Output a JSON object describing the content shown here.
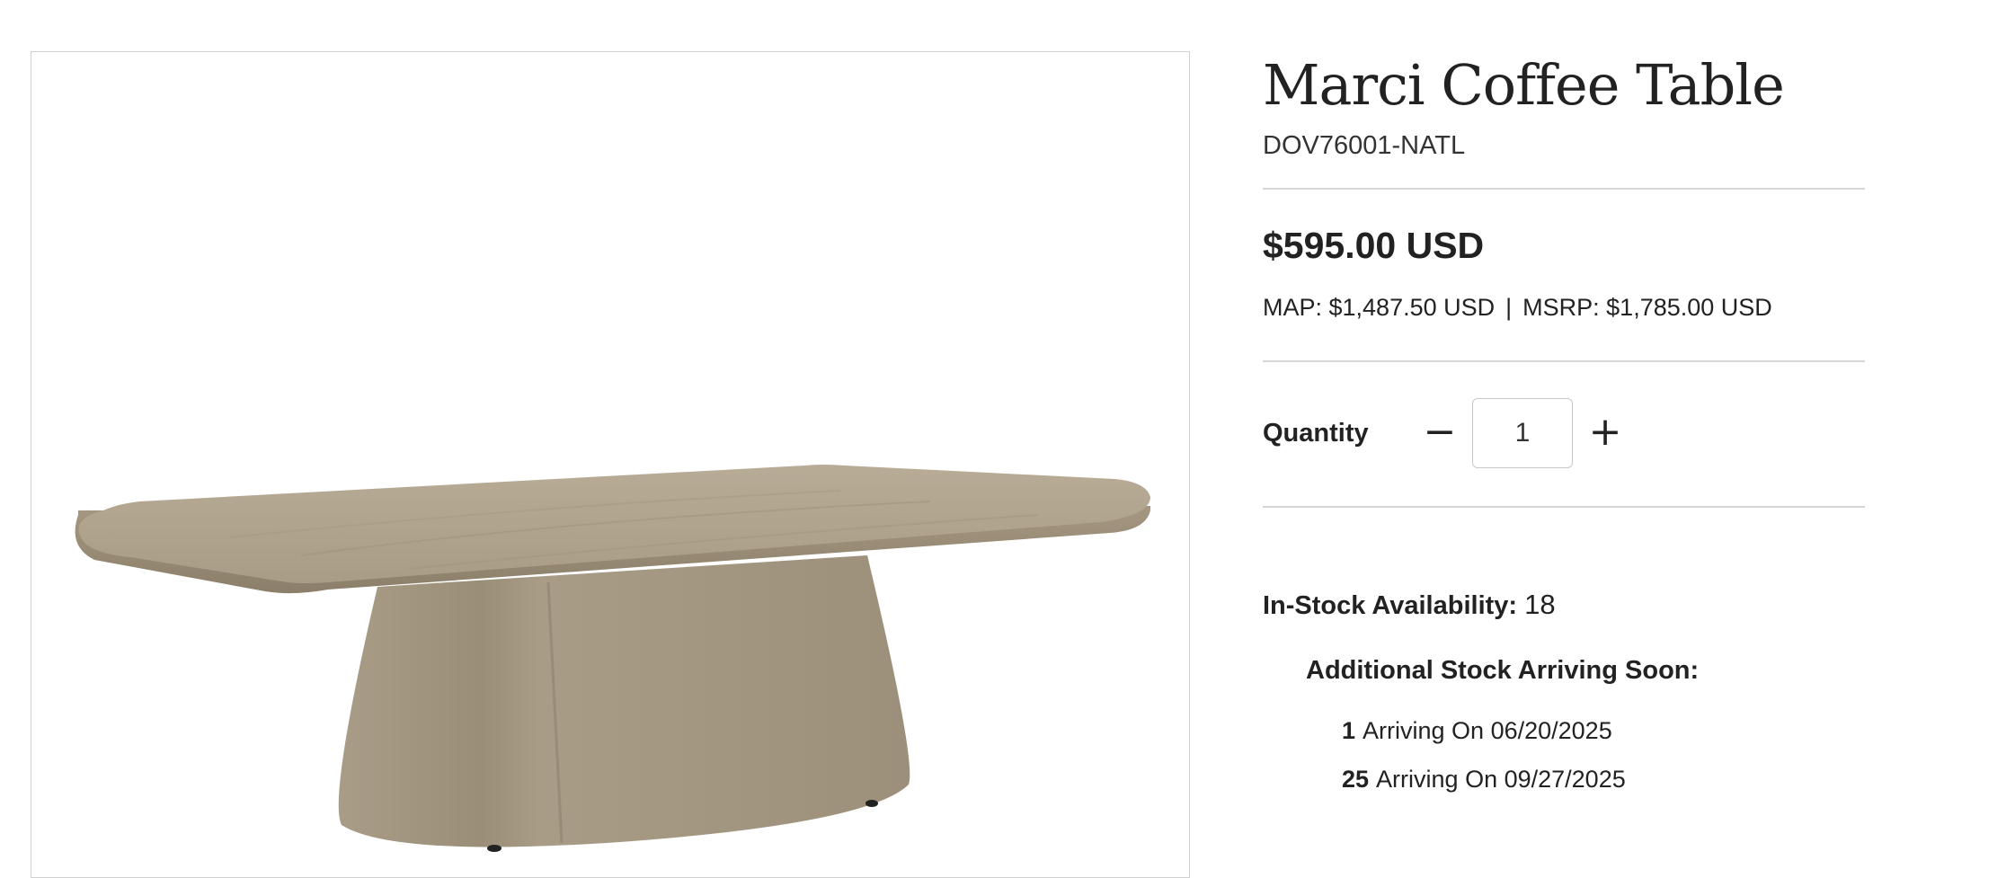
{
  "product": {
    "title": "Marci Coffee Table",
    "sku": "DOV76001-NATL",
    "image_subject": "wood-coffee-table"
  },
  "pricing": {
    "price": "$595.00 USD",
    "map_label": "MAP: $1,487.50 USD",
    "separator": "|",
    "msrp_label": "MSRP: $1,785.00 USD"
  },
  "quantity": {
    "label": "Quantity",
    "value": "1",
    "decrement_symbol": "−",
    "increment_symbol": "+"
  },
  "availability": {
    "label": "In-Stock Availability:",
    "count": "18",
    "arriving_title": "Additional Stock Arriving Soon:",
    "arrivals": [
      {
        "qty": "1",
        "text": "Arriving On 06/20/2025"
      },
      {
        "qty": "25",
        "text": "Arriving On 09/27/2025"
      }
    ]
  },
  "colors": {
    "text": "#222222",
    "divider": "#d6d6d6",
    "wood_light": "#b4a792",
    "wood_dark": "#8f8470"
  }
}
